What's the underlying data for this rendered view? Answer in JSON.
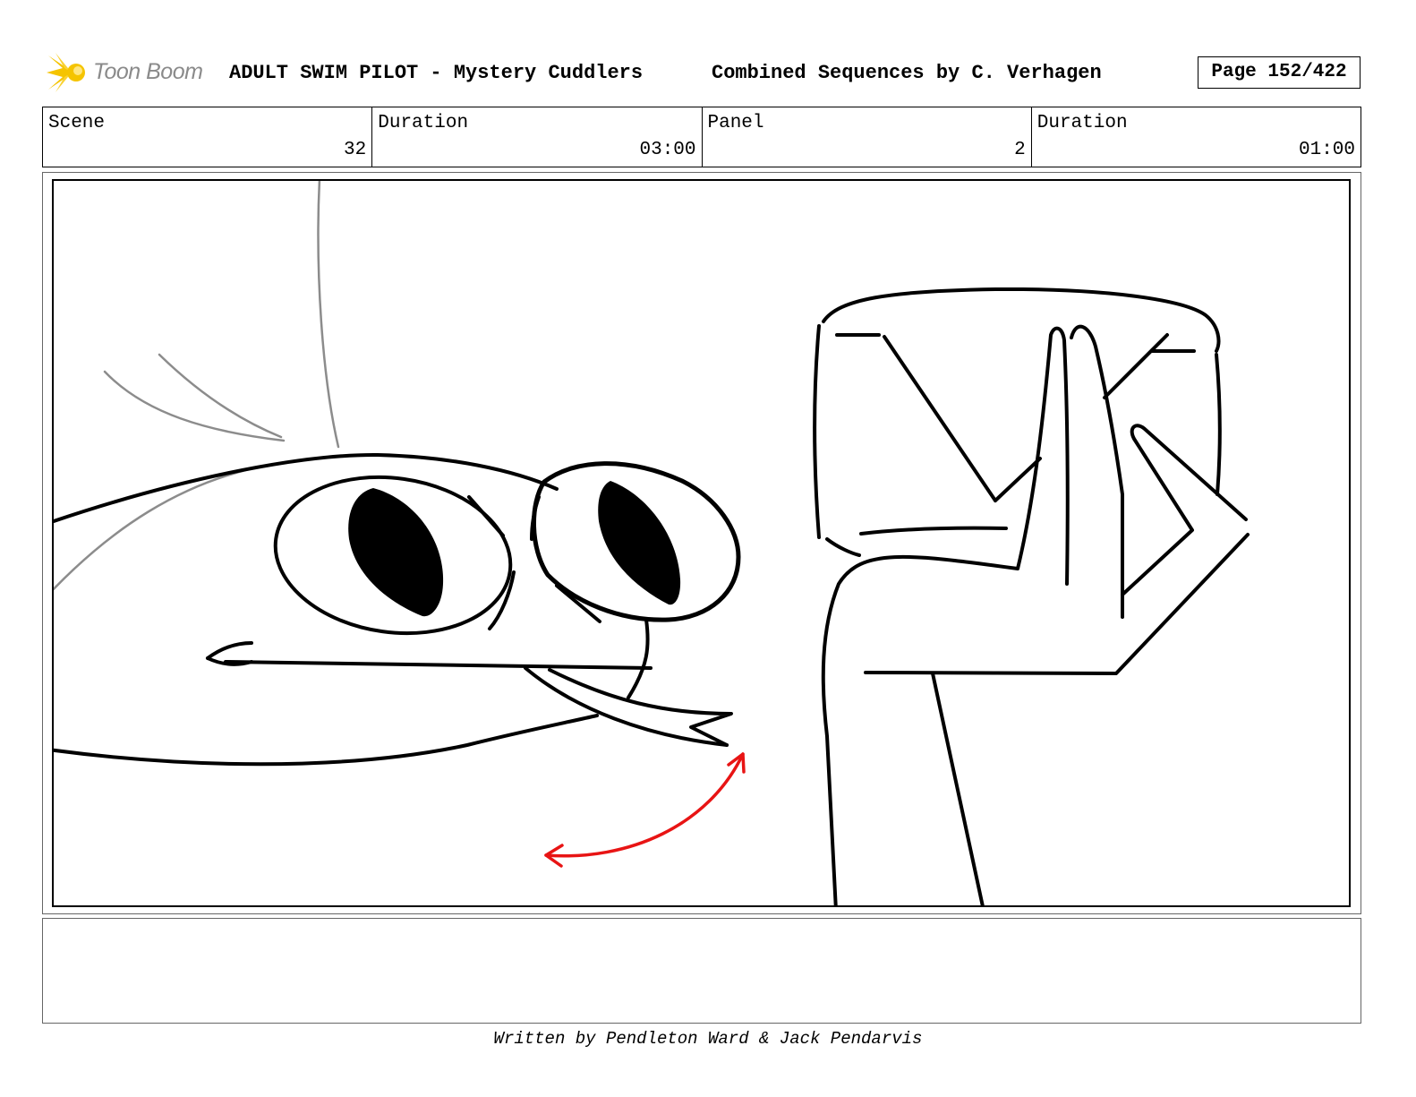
{
  "header": {
    "logo_text": "Toon Boom",
    "project_title": "ADULT SWIM PILOT - Mystery Cuddlers",
    "sequence_title": "Combined Sequences by C. Verhagen",
    "page": "Page 152/422"
  },
  "info_bar": {
    "scene_label": "Scene",
    "scene_value": "32",
    "scene_duration_label": "Duration",
    "scene_duration_value": "03:00",
    "panel_label": "Panel",
    "panel_value": "2",
    "panel_duration_label": "Duration",
    "panel_duration_value": "01:00"
  },
  "notes": "",
  "footer": {
    "credits": "Written by Pendleton Ward & Jack Pendarvis"
  },
  "colors": {
    "logo_star": "#f5c400",
    "logo_text": "#8a8a8a",
    "action_arrow": "#e81414",
    "construction_lines": "#8c8c8c"
  }
}
